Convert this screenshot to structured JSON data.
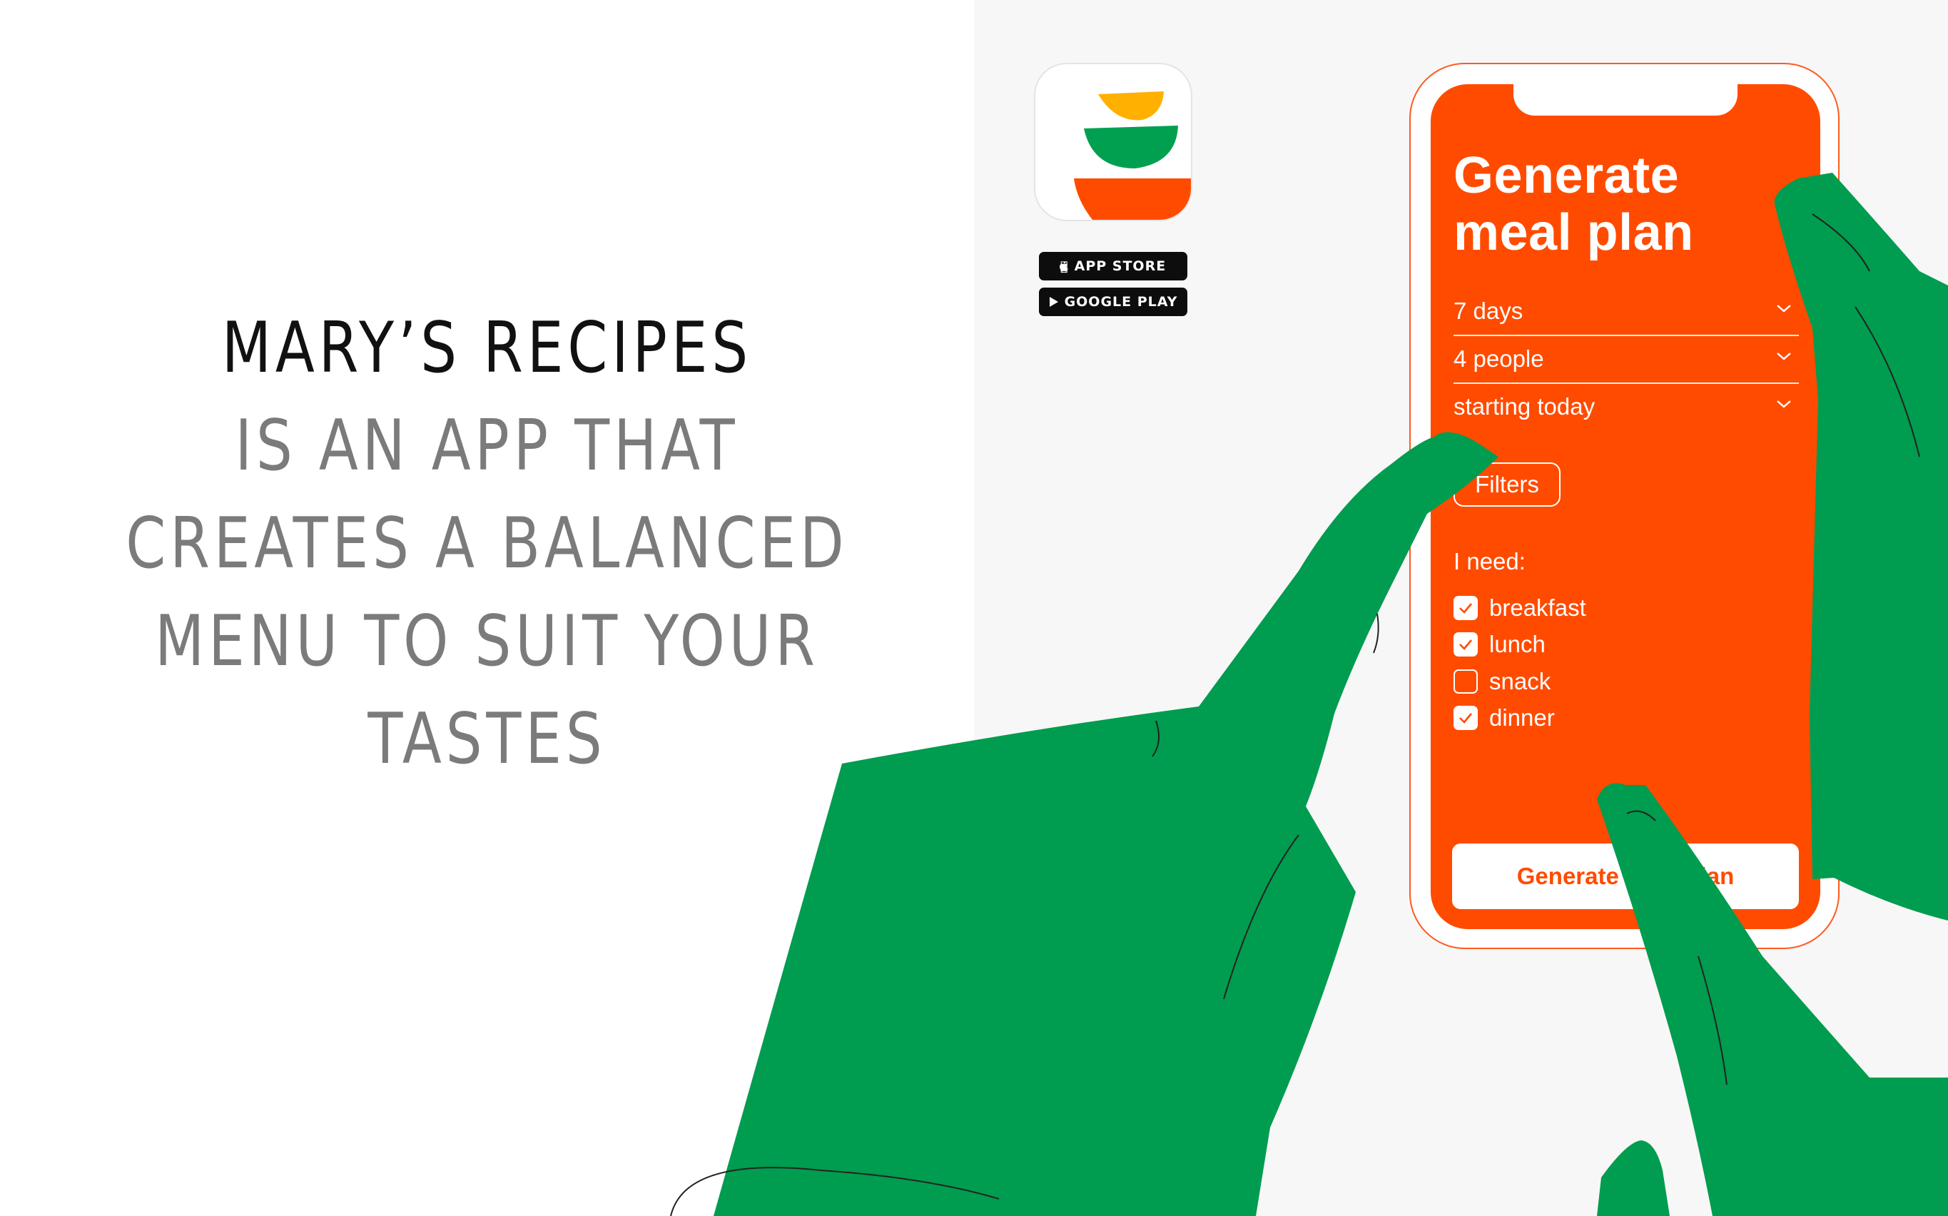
{
  "headline": {
    "line1": "MARY’S RECIPES",
    "line2": "IS AN APP THAT",
    "line3": "CREATES A BALANCED",
    "line4": "MENU TO SUIT YOUR",
    "line5": "TASTES"
  },
  "store_buttons": {
    "app_store": "APP STORE",
    "google_play": "GOOGLE PLAY"
  },
  "app": {
    "title": "Generate\nmeal plan",
    "title_line1": "Generate",
    "title_line2": "meal plan",
    "dropdowns": [
      {
        "value": "7 days"
      },
      {
        "value": "4 people"
      },
      {
        "value": "starting today"
      }
    ],
    "filters_label": "Filters",
    "need_label": "I need:",
    "meals": [
      {
        "label": "breakfast",
        "checked": true
      },
      {
        "label": "lunch",
        "checked": true
      },
      {
        "label": "snack",
        "checked": false
      },
      {
        "label": "dinner",
        "checked": true
      }
    ],
    "generate_button": "Generate meal plan"
  },
  "colors": {
    "accent_orange": "#ff4b00",
    "hand_green": "#009c4f",
    "icon_yellow": "#ffb000",
    "icon_green": "#00a050",
    "icon_orange": "#ff4b00"
  }
}
